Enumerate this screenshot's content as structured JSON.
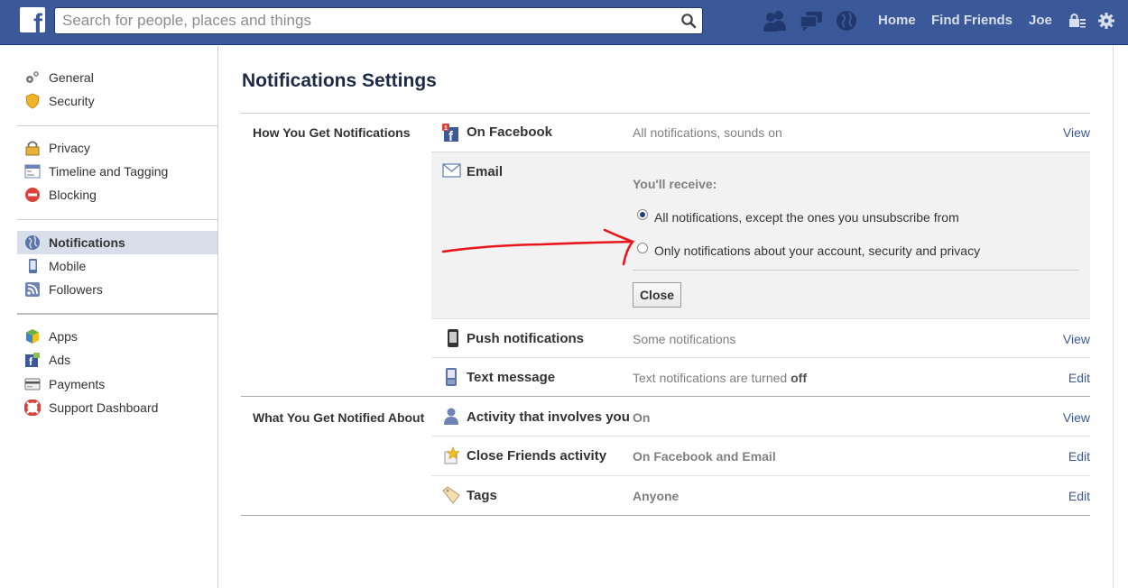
{
  "topbar": {
    "logo": "f",
    "search_placeholder": "Search for people, places and things",
    "nav": [
      "Home",
      "Find Friends",
      "Joe"
    ],
    "icons": [
      "friend-requests-icon",
      "messages-icon",
      "notifications-globe-icon",
      "privacy-shortcuts-lock-icon",
      "settings-gear-icon"
    ]
  },
  "sidebar": {
    "groups": [
      [
        {
          "label": "General",
          "icon": "gears-icon"
        },
        {
          "label": "Security",
          "icon": "badge-icon"
        }
      ],
      [
        {
          "label": "Privacy",
          "icon": "lock-icon"
        },
        {
          "label": "Timeline and Tagging",
          "icon": "timeline-icon"
        },
        {
          "label": "Blocking",
          "icon": "blocking-icon"
        }
      ],
      [
        {
          "label": "Notifications",
          "icon": "globe-icon",
          "active": true
        },
        {
          "label": "Mobile",
          "icon": "mobile-icon"
        },
        {
          "label": "Followers",
          "icon": "rss-icon"
        }
      ],
      [
        {
          "label": "Apps",
          "icon": "cube-icon"
        },
        {
          "label": "Ads",
          "icon": "ads-icon"
        },
        {
          "label": "Payments",
          "icon": "credit-card-icon"
        },
        {
          "label": "Support Dashboard",
          "icon": "lifebuoy-icon"
        }
      ]
    ]
  },
  "main": {
    "title": "Notifications Settings",
    "section_how": "How You Get Notifications",
    "section_what": "What You Get Notified About",
    "rows": {
      "on_facebook": {
        "name": "On Facebook",
        "value": "All notifications, sounds on",
        "link": "View"
      },
      "email": {
        "name": "Email"
      },
      "push": {
        "name": "Push notifications",
        "value": "Some notifications",
        "link": "View"
      },
      "text": {
        "name": "Text message",
        "value_prefix": "Text notifications are turned ",
        "value_bold": "off",
        "link": "Edit"
      },
      "activity": {
        "name": "Activity that involves you",
        "value": "On",
        "link": "View"
      },
      "close_friends": {
        "name": "Close Friends activity",
        "value": "On Facebook and Email",
        "link": "Edit"
      },
      "tags": {
        "name": "Tags",
        "value": "Anyone",
        "link": "Edit"
      }
    },
    "email_panel": {
      "receive_label": "You'll receive:",
      "options": [
        "All notifications, except the ones you unsubscribe from",
        "Only notifications about your account, security and privacy"
      ],
      "selected": 0,
      "close_label": "Close"
    }
  },
  "colors": {
    "brand": "#3b5998",
    "link": "#3b5998",
    "annotation": "#e8151b"
  }
}
